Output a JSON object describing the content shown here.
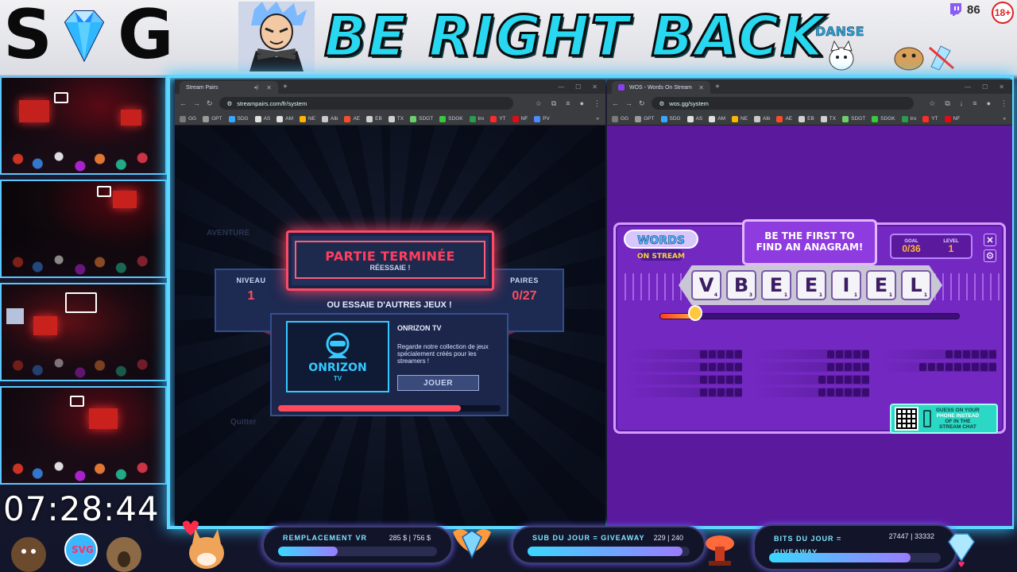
{
  "banner": {
    "logo_left": "S",
    "logo_right": "G",
    "title": "BE RIGHT BACK",
    "danse_label": "DANSE",
    "viewer_count": "86",
    "age_badge": "18+"
  },
  "clock": "07:28:44",
  "browser_left": {
    "tab_title": "Stream Pairs",
    "url": "streampairs.com/fr/system",
    "bookmarks": [
      "GG",
      "GPT",
      "SDG",
      "AS",
      "AM",
      "NE",
      "Alb",
      "AE",
      "EB",
      "TX",
      "SDGT",
      "SDGK",
      "tro",
      "YT",
      "NF",
      "PV"
    ]
  },
  "browser_right": {
    "tab_title": "WOS - Words On Stream",
    "url": "wos.gg/system",
    "bookmarks": [
      "GG",
      "GPT",
      "SDG",
      "AS",
      "AM",
      "NE",
      "Alb",
      "AE",
      "EB",
      "TX",
      "SDGT",
      "SDGK",
      "tro",
      "YT",
      "NF"
    ]
  },
  "pairs": {
    "title": "PARTIE TERMINÉE",
    "subtitle": "RÉESSAIE !",
    "niveau_label": "NIVEAU",
    "niveau_value": "1",
    "paires_label": "PAIRES",
    "paires_value": "0/27",
    "try_other": "OU ESSAIE D'AUTRES JEUX !",
    "promo_name": "ONRIZON",
    "promo_sub": "TV",
    "promo_title": "ONRIZON TV",
    "promo_desc": "Regarde notre collection de jeux spécialement créés pour les streamers !",
    "play_button": "JOUER",
    "progress": 0.82
  },
  "wos": {
    "logo_top": "WORDS",
    "logo_bottom": "ON STREAM",
    "prompt": "BE THE FIRST TO FIND AN ANAGRAM!",
    "goal_label": "GOAL",
    "goal_value": "0/36",
    "level_label": "LEVEL",
    "level_value": "1",
    "close_label": "✕",
    "letters": [
      {
        "l": "V",
        "p": "4"
      },
      {
        "l": "B",
        "p": "3"
      },
      {
        "l": "E",
        "p": "1"
      },
      {
        "l": "E",
        "p": "1"
      },
      {
        "l": "I",
        "p": "1"
      },
      {
        "l": "E",
        "p": "1"
      },
      {
        "l": "L",
        "p": "1"
      }
    ],
    "timer_progress": 0.12,
    "guess_line1": "GUESS ON YOUR",
    "guess_line2": "PHONE INSTEAD",
    "guess_line3": "OF IN THE",
    "guess_line4": "STREAM CHAT"
  },
  "goals": [
    {
      "label": "REMPLACEMENT VR",
      "value": "285 $ | 756 $",
      "progress": 0.377
    },
    {
      "label": "SUB DU JOUR = GIVEAWAY",
      "value": "229 | 240",
      "progress": 0.954
    },
    {
      "label": "BITS DU JOUR = GIVEAWAY",
      "value": "27447 | 33332",
      "progress": 0.823
    }
  ],
  "colors": {
    "accent_cyan": "#27d8f0",
    "pairs_red": "#ff3e5e",
    "wos_purple": "#7428c2"
  }
}
